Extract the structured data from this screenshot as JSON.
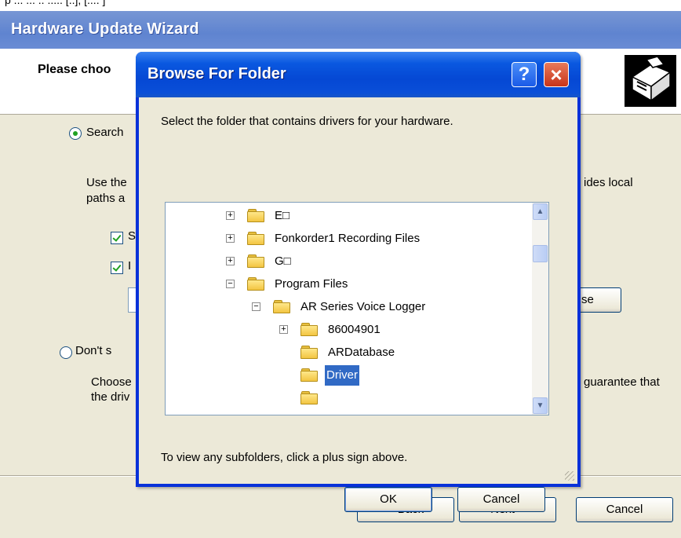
{
  "top_strip": {
    "text": "p ... ... .. ..... [..], [.... ]"
  },
  "wizard": {
    "title": "Hardware Update Wizard",
    "heading": "Please choo",
    "search_option": "Search",
    "search_desc_line1": "Use the",
    "search_desc_line1_right": "ides local",
    "search_desc_line2": "paths a",
    "check1_label": "S",
    "check2_label": "I",
    "browse_button": "se",
    "dont_option": "Don't s",
    "dont_desc_line1": "Choose",
    "dont_desc_line1_right": "guarantee that",
    "dont_desc_line2": "the driv",
    "back_button": "< Back",
    "next_button": "Next >",
    "cancel_button": "Cancel"
  },
  "browse_dialog": {
    "title": "Browse For Folder",
    "help_icon": "?",
    "close_icon": "×",
    "description": "Select the folder that contains drivers for your hardware.",
    "tree": [
      {
        "label": "E□",
        "expander": "+",
        "selected": false
      },
      {
        "label": "Fonkorder1 Recording Files",
        "expander": "+",
        "selected": false
      },
      {
        "label": "G□",
        "expander": "+",
        "selected": false
      },
      {
        "label": "Program Files",
        "expander": "−",
        "selected": false
      },
      {
        "label": "AR Series Voice Logger",
        "expander": "−",
        "selected": false
      },
      {
        "label": "86004901",
        "expander": "+",
        "selected": false
      },
      {
        "label": "ARDatabase",
        "expander": "",
        "selected": false
      },
      {
        "label": "Driver",
        "expander": "",
        "selected": true
      }
    ],
    "hint": "To view any subfolders, click a plus sign above.",
    "ok_button": "OK",
    "cancel_button": "Cancel"
  },
  "colors": {
    "titlebar_blue": "#0a4fd8",
    "selection": "#316ac5",
    "dialog_face": "#ece9d8"
  }
}
